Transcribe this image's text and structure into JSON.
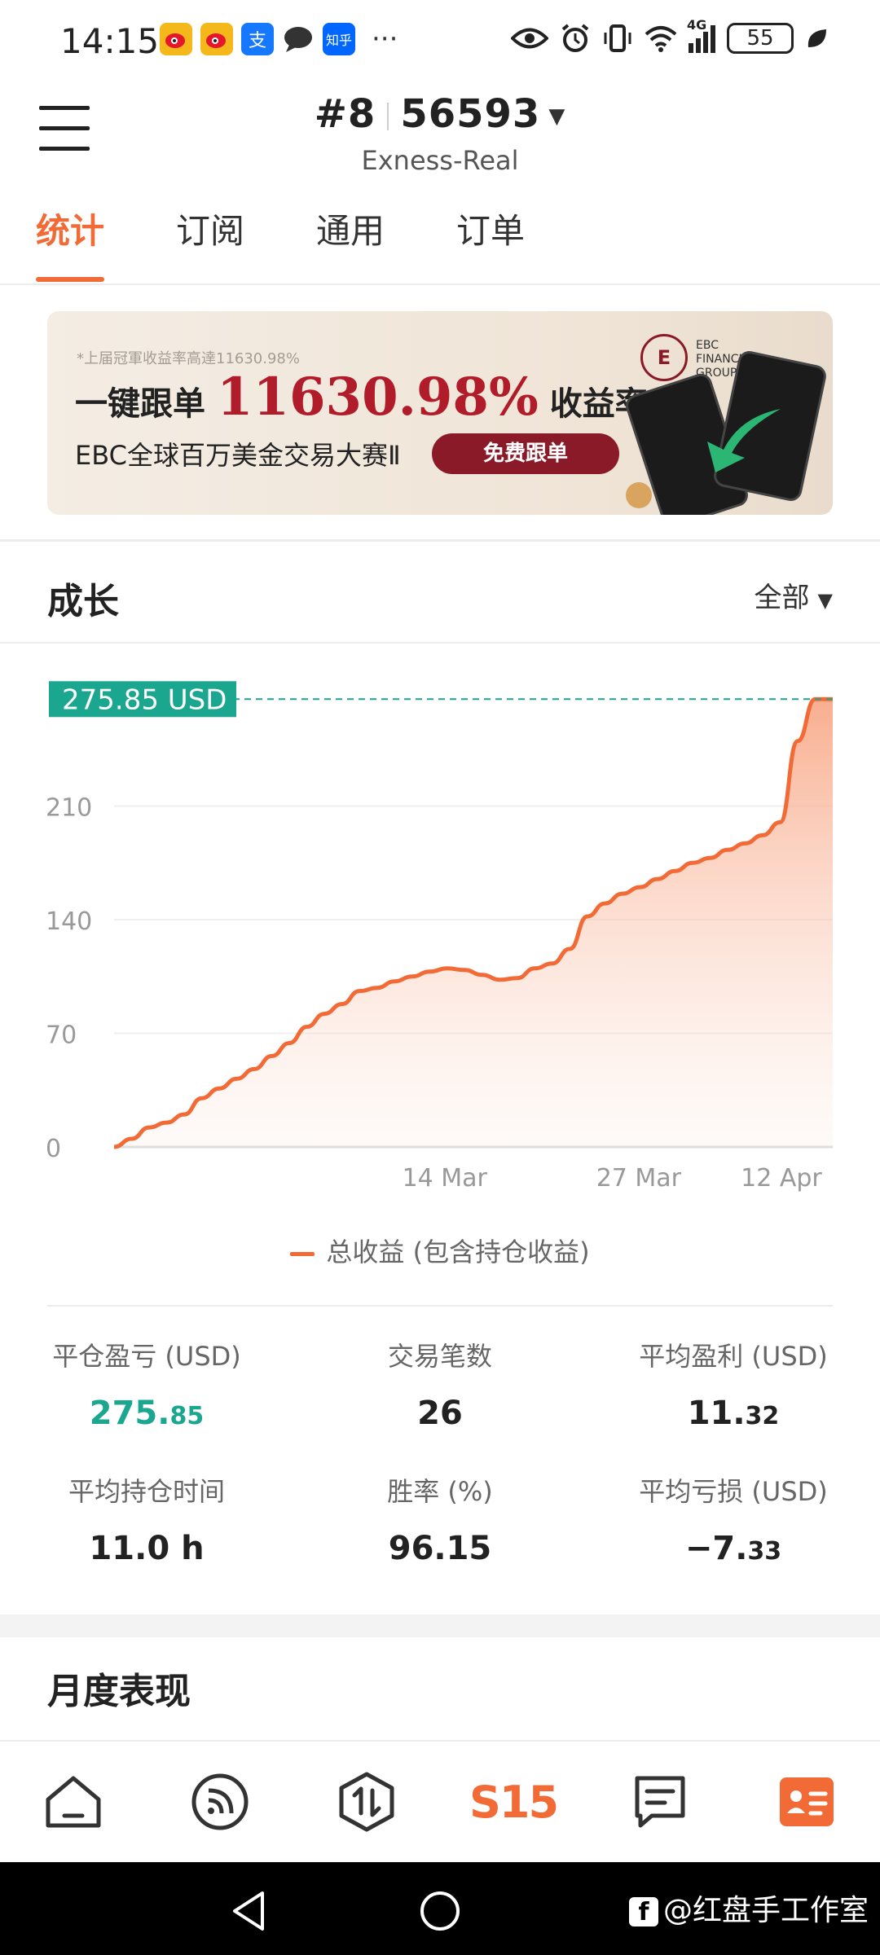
{
  "status_bar": {
    "time": "14:15",
    "apps": [
      {
        "icon": "weibo-icon",
        "color": "#f5b81b"
      },
      {
        "icon": "weibo-icon",
        "color": "#f5b81b"
      },
      {
        "icon": "alipay-icon",
        "color": "#1677ff",
        "text": "支"
      },
      {
        "icon": "chat-bubble-icon",
        "color": "#333333"
      },
      {
        "icon": "zhihu-icon",
        "color": "#0066ff",
        "text": "知乎"
      }
    ],
    "more": "···",
    "network": "4G",
    "battery": "55"
  },
  "header": {
    "rank": "#8",
    "account_number": "56593",
    "broker": "Exness-Real"
  },
  "tabs": [
    {
      "label": "统计",
      "active": true
    },
    {
      "label": "订阅",
      "active": false
    },
    {
      "label": "通用",
      "active": false
    },
    {
      "label": "订单",
      "active": false
    }
  ],
  "banner": {
    "note": "*上届冠軍收益率高達11630.98%",
    "headline_prefix": "一键跟单",
    "headline_value": "11630.98%",
    "headline_suffix": "收益率",
    "subline": "EBC全球百万美金交易大赛Ⅱ",
    "button": "免费跟单",
    "logo_text": "EBC FINANCIAL GROUP"
  },
  "growth": {
    "title": "成长",
    "filter": "全部"
  },
  "chart_data": {
    "type": "area",
    "current_label": "275.85 USD",
    "y_ticks": [
      "0",
      "70",
      "140",
      "210"
    ],
    "ylim": [
      0,
      280
    ],
    "x_ticks": [
      "14 Mar",
      "27 Mar",
      "12 Apr"
    ],
    "series": [
      {
        "name": "总收益 (包含持仓收益)",
        "color": "#f26b36",
        "values": [
          0,
          5,
          12,
          15,
          20,
          30,
          36,
          42,
          48,
          56,
          64,
          74,
          82,
          88,
          96,
          98,
          102,
          105,
          108,
          110,
          109,
          106,
          103,
          104,
          110,
          113,
          122,
          142,
          150,
          156,
          160,
          165,
          170,
          175,
          178,
          183,
          187,
          192,
          200,
          250,
          275.85,
          275.85
        ]
      }
    ]
  },
  "legend": {
    "label": "总收益 (包含持仓收益)"
  },
  "stats": [
    {
      "label": "平仓盈亏 (USD)",
      "int": "275.",
      "frac": "85",
      "green": true
    },
    {
      "label": "交易笔数",
      "int": "26",
      "frac": "",
      "green": false
    },
    {
      "label": "平均盈利 (USD)",
      "int": "11.",
      "frac": "32",
      "green": false
    },
    {
      "label": "平均持仓时间",
      "int": "11.0 h",
      "frac": "",
      "green": false
    },
    {
      "label": "胜率 (%)",
      "int": "96.15",
      "frac": "",
      "green": false
    },
    {
      "label": "平均亏损 (USD)",
      "int": "−7.",
      "frac": "33",
      "green": false
    }
  ],
  "monthly": {
    "title": "月度表现"
  },
  "bottom_nav": [
    {
      "icon": "home-icon"
    },
    {
      "icon": "signal-feed-icon"
    },
    {
      "icon": "trade-icon"
    },
    {
      "icon": "s15-logo-icon",
      "text": "S15"
    },
    {
      "icon": "messages-icon"
    },
    {
      "icon": "profile-card-icon",
      "active": true
    }
  ],
  "watermark": "@红盘手工作室",
  "colors": {
    "accent": "#f26b36",
    "profit_green": "#1aa68f",
    "label_bg": "#1aa68f"
  }
}
